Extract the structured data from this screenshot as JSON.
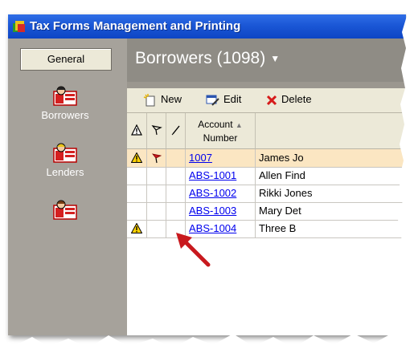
{
  "window": {
    "title": "Tax Forms Management and Printing"
  },
  "sidebar": {
    "general_label": "General",
    "items": [
      {
        "label": "Borrowers",
        "icon": "borrowers-icon"
      },
      {
        "label": "Lenders",
        "icon": "lenders-icon"
      },
      {
        "label": "",
        "icon": "form-icon"
      }
    ]
  },
  "main": {
    "title": "Borrowers (1098)",
    "toolbar": {
      "new_label": "New",
      "edit_label": "Edit",
      "delete_label": "Delete"
    },
    "columns": {
      "warning": "warning-icon",
      "flag": "flag-icon",
      "edit": "pencil-icon",
      "account_line1": "Account",
      "account_line2": "Number"
    },
    "rows": [
      {
        "warning": true,
        "flag": true,
        "account": "1007",
        "name": "James Jo"
      },
      {
        "warning": false,
        "flag": false,
        "account": "ABS-1001",
        "name": "Allen Find"
      },
      {
        "warning": false,
        "flag": false,
        "account": "ABS-1002",
        "name": "Rikki Jones"
      },
      {
        "warning": false,
        "flag": false,
        "account": "ABS-1003",
        "name": "Mary Det"
      },
      {
        "warning": true,
        "flag": false,
        "account": "ABS-1004",
        "name": "Three B"
      }
    ]
  },
  "colors": {
    "titlebar": "#1b57d6",
    "selected_row": "#fbe6c2",
    "link": "#0000ee",
    "arrow": "#c8191e"
  }
}
